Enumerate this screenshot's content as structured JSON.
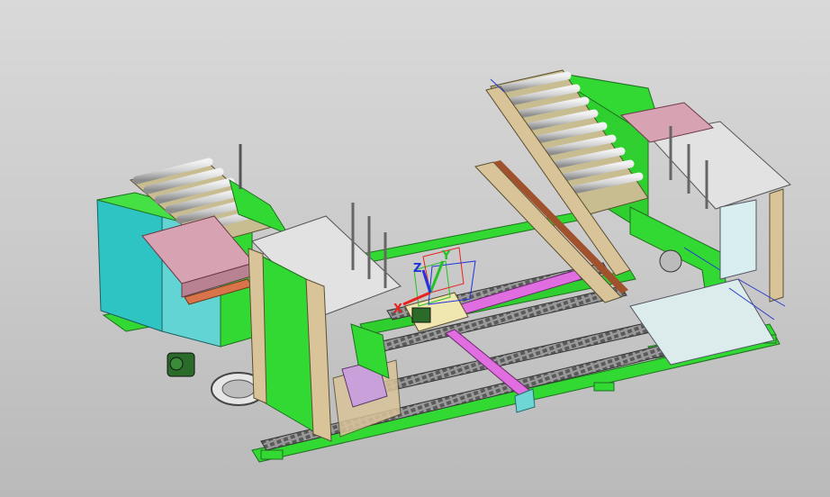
{
  "view": {
    "background_top": "#d9d9d9",
    "background_bottom": "#b9b9b9"
  },
  "colors": {
    "machine_green": "#33d933",
    "cyan_panel": "#2ec4c4",
    "pink_cover": "#d7a2b2",
    "roller_grey": "#d8d8d8",
    "tan_frame": "#d9c49a",
    "magenta_rail": "#e06ee0",
    "steel_grey": "#cfd3d3"
  },
  "triad": {
    "x_label": "X",
    "y_label": "Y",
    "z_label": "Z",
    "x_color": "#e8221f",
    "y_color": "#22c322",
    "z_color": "#2233dd"
  },
  "icons": [
    "coordinate-triad-icon"
  ]
}
